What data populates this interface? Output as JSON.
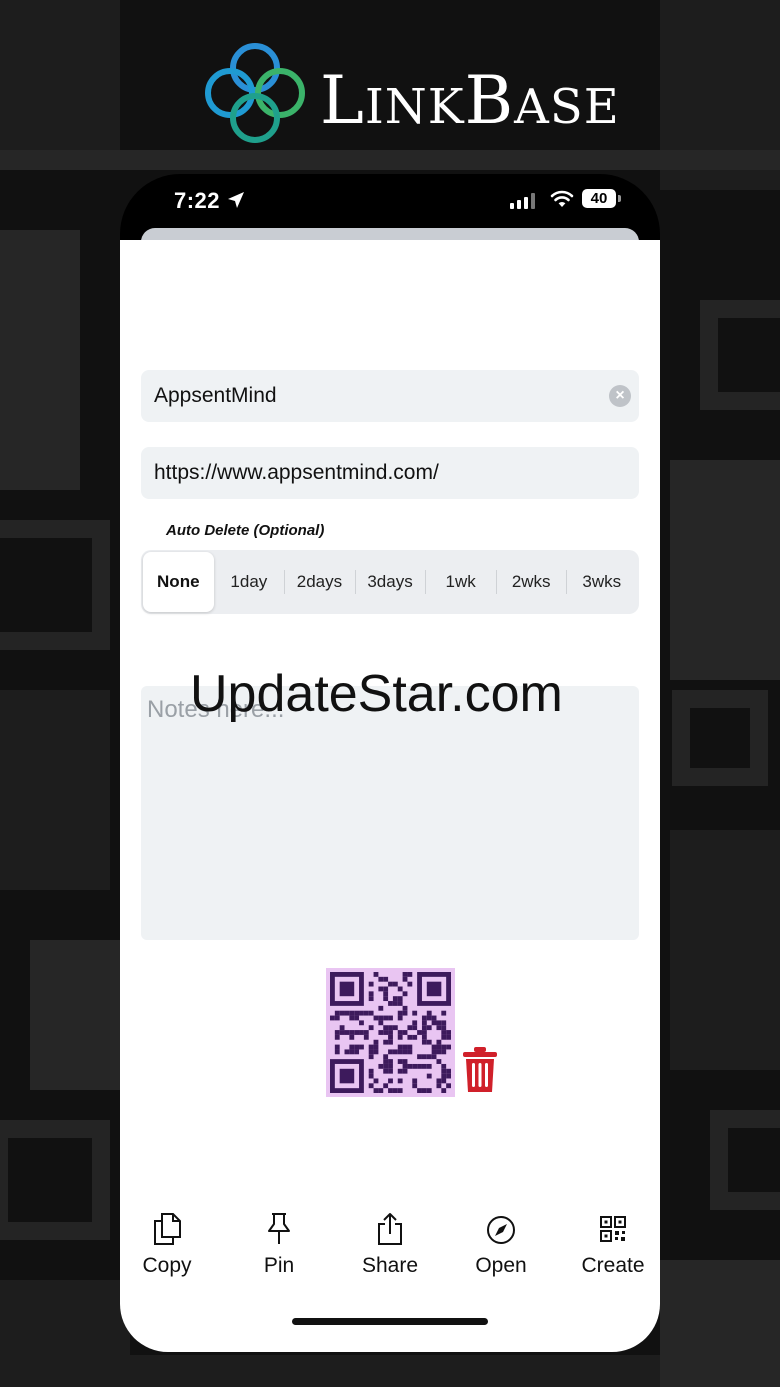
{
  "header": {
    "logo_text_initial_1": "L",
    "logo_text_rest_1": "INK",
    "logo_text_initial_2": "B",
    "logo_text_rest_2": "ASE"
  },
  "status_bar": {
    "time": "7:22",
    "battery": "40"
  },
  "form": {
    "name_value": "AppsentMind",
    "url_value": "https://www.appsentmind.com/",
    "auto_delete_label": "Auto Delete (Optional)",
    "auto_delete_options": [
      "None",
      "1day",
      "2days",
      "3days",
      "1wk",
      "2wks",
      "3wks"
    ],
    "selected_option": "None",
    "notes_placeholder": "Notes here..."
  },
  "watermark": "UpdateStar.com",
  "toolbar": {
    "copy_label": "Copy",
    "pin_label": "Pin",
    "share_label": "Share",
    "open_label": "Open",
    "create_label": "Create"
  },
  "icons": [
    "linkbase-logo-icon",
    "location-arrow-icon",
    "signal-icon",
    "wifi-icon",
    "battery-icon",
    "clear-icon",
    "qr-code-icon",
    "trash-icon",
    "copy-icon",
    "pin-icon",
    "share-icon",
    "compass-icon",
    "qr-create-icon"
  ],
  "colors": {
    "qr_background": "#e9c5f2",
    "qr_modules": "#3d1a5c",
    "trash": "#d0202a",
    "field_background": "#eff2f4"
  }
}
